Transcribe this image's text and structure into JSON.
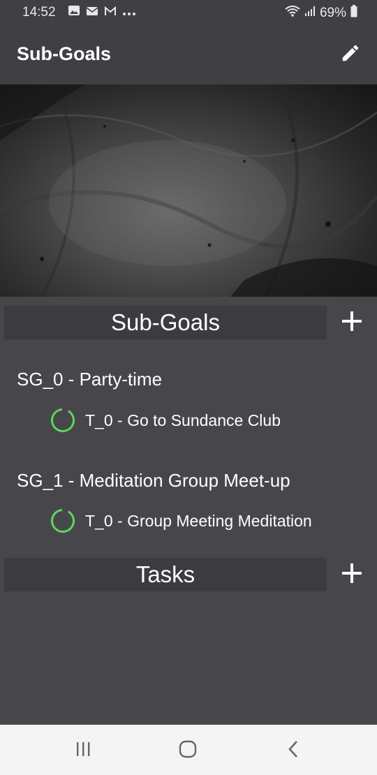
{
  "status_bar": {
    "time": "14:52",
    "battery": "69%",
    "icons": [
      "image-icon",
      "mail-icon",
      "gmail-icon",
      "more-dots-icon",
      "wifi-icon",
      "signal-icon",
      "battery-icon"
    ]
  },
  "app_bar": {
    "title": "Sub-Goals",
    "edit_icon": "pencil-icon"
  },
  "sections": {
    "subgoals_header": "Sub-Goals",
    "tasks_header": "Tasks"
  },
  "subgoals": [
    {
      "title": "SG_0  -  Party-time",
      "tasks": [
        {
          "label": "T_0  -  Go to Sundance Club"
        }
      ]
    },
    {
      "title": "SG_1  -  Meditation Group Meet-up",
      "tasks": [
        {
          "label": "T_0  -  Group Meeting Meditation"
        }
      ]
    }
  ],
  "colors": {
    "background": "#47474b",
    "app_bar": "#404044",
    "section_header": "#3c3c40",
    "progress_ring": "#5cd65c",
    "nav_bar": "#f4f4f4"
  },
  "nav_bar": {
    "icons": [
      "recent-apps-icon",
      "home-icon",
      "back-icon"
    ]
  }
}
